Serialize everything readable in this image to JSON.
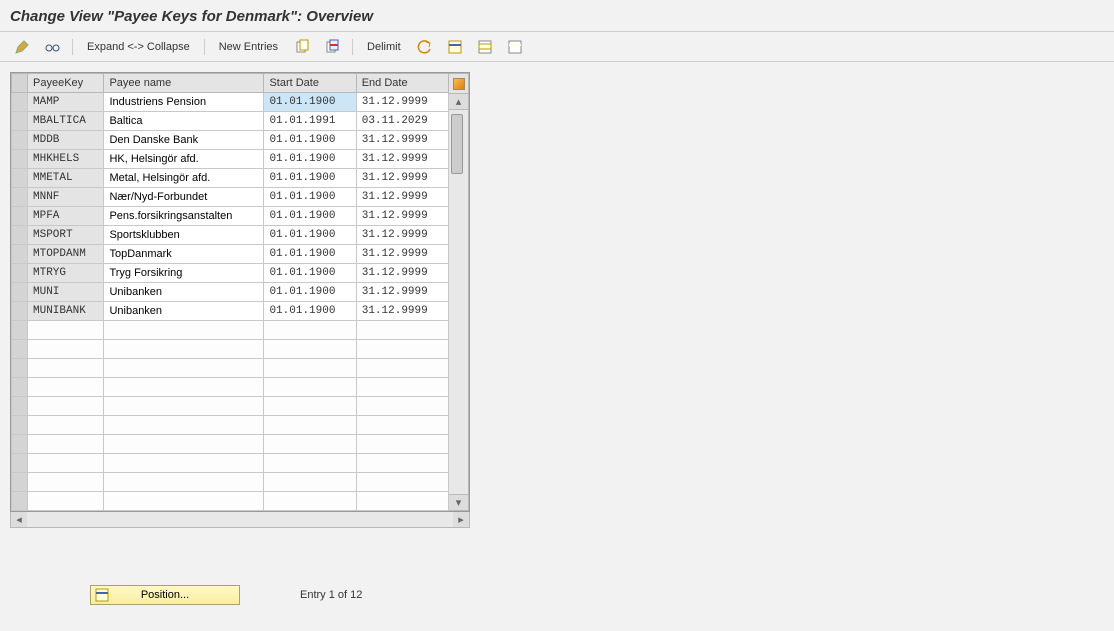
{
  "header": {
    "title": "Change View \"Payee Keys for Denmark\": Overview"
  },
  "toolbar": {
    "expand_collapse": "Expand <-> Collapse",
    "new_entries": "New Entries",
    "delimit": "Delimit"
  },
  "table": {
    "columns": {
      "payee_key": "PayeeKey",
      "payee_name": "Payee name",
      "start_date": "Start Date",
      "end_date": "End Date"
    },
    "rows": [
      {
        "key": "MAMP",
        "name": "Industriens Pension",
        "start": "01.01.1900",
        "end": "31.12.9999",
        "highlighted": true
      },
      {
        "key": "MBALTICA",
        "name": "Baltica",
        "start": "01.01.1991",
        "end": "03.11.2029"
      },
      {
        "key": "MDDB",
        "name": "Den Danske Bank",
        "start": "01.01.1900",
        "end": "31.12.9999"
      },
      {
        "key": "MHKHELS",
        "name": "HK, Helsingör afd.",
        "start": "01.01.1900",
        "end": "31.12.9999"
      },
      {
        "key": "MMETAL",
        "name": "Metal, Helsingör afd.",
        "start": "01.01.1900",
        "end": "31.12.9999"
      },
      {
        "key": "MNNF",
        "name": "Nær/Nyd-Forbundet",
        "start": "01.01.1900",
        "end": "31.12.9999"
      },
      {
        "key": "MPFA",
        "name": "Pens.forsikringsanstalten",
        "start": "01.01.1900",
        "end": "31.12.9999"
      },
      {
        "key": "MSPORT",
        "name": "Sportsklubben",
        "start": "01.01.1900",
        "end": "31.12.9999"
      },
      {
        "key": "MTOPDANM",
        "name": "TopDanmark",
        "start": "01.01.1900",
        "end": "31.12.9999"
      },
      {
        "key": "MTRYG",
        "name": "Tryg Forsikring",
        "start": "01.01.1900",
        "end": "31.12.9999"
      },
      {
        "key": "MUNI",
        "name": "Unibanken",
        "start": "01.01.1900",
        "end": "31.12.9999"
      },
      {
        "key": "MUNIBANK",
        "name": "Unibanken",
        "start": "01.01.1900",
        "end": "31.12.9999"
      }
    ],
    "empty_rows": 10
  },
  "footer": {
    "position_label": "Position...",
    "entry_text": "Entry 1 of 12"
  },
  "icons": {
    "toggle": "toggle-icon",
    "glasses": "display-icon",
    "copy": "copy-icon",
    "copy2": "copy-all-icon",
    "delete": "delete-icon",
    "undo": "undo-icon",
    "select_all": "select-all-icon",
    "select_block": "select-block-icon",
    "deselect": "deselect-icon",
    "config": "configure-icon",
    "position": "position-icon"
  }
}
